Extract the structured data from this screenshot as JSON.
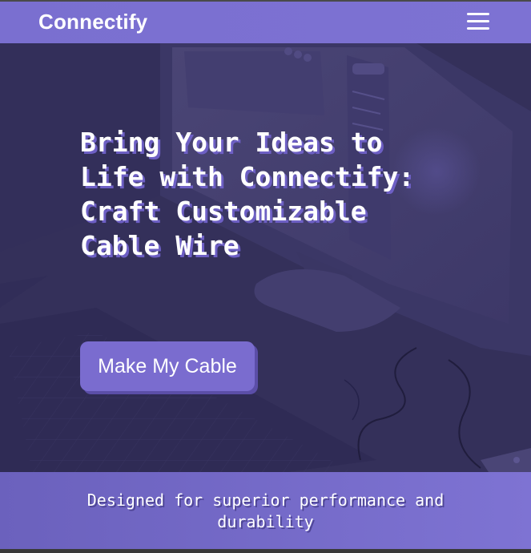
{
  "navbar": {
    "brand": "Connectify",
    "menu_icon": "hamburger-menu-icon"
  },
  "hero": {
    "headline": "Bring Your Ideas to Life with Connectify: Craft Customizable Cable Wire",
    "cta_label": "Make My Cable"
  },
  "tagline": {
    "text": "Designed for superior performance and durability"
  },
  "colors": {
    "accent": "#7a6fd0",
    "hero_bg": "#34305a",
    "text": "#ffffff"
  }
}
